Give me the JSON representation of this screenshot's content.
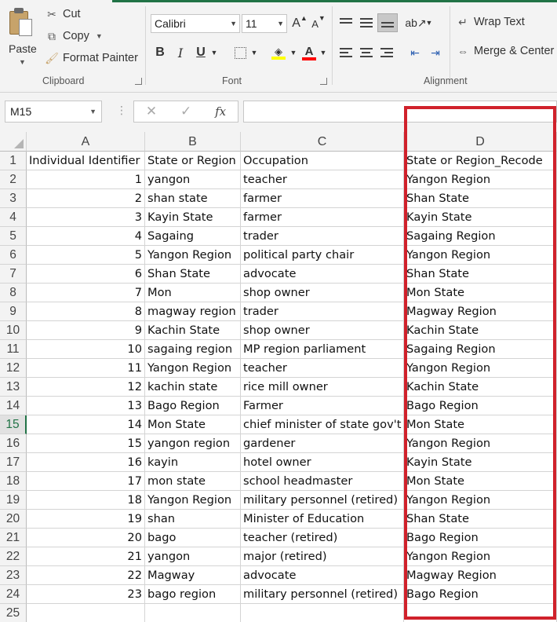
{
  "ribbon": {
    "clipboard": {
      "group_label": "Clipboard",
      "paste": "Paste",
      "cut": "Cut",
      "copy": "Copy",
      "format_painter": "Format Painter"
    },
    "font": {
      "group_label": "Font",
      "font_name": "Calibri",
      "font_size": "11",
      "bold": "B",
      "italic": "I",
      "underline": "U",
      "grow": "A",
      "shrink": "A",
      "font_color_letter": "A",
      "fill_color": "#ffff00",
      "font_color": "#ff0000"
    },
    "alignment": {
      "group_label": "Alignment",
      "wrap_text": "Wrap Text",
      "merge_center": "Merge & Center"
    }
  },
  "formula_bar": {
    "name_box": "M15",
    "cancel": "✕",
    "enter": "✓",
    "fx": "fx",
    "formula": ""
  },
  "sheet": {
    "columns": [
      "A",
      "B",
      "C",
      "D"
    ],
    "active_row": "15",
    "row_numbers": [
      "1",
      "2",
      "3",
      "4",
      "5",
      "6",
      "7",
      "8",
      "9",
      "10",
      "11",
      "12",
      "13",
      "14",
      "15",
      "16",
      "17",
      "18",
      "19",
      "20",
      "21",
      "22",
      "23",
      "24",
      "25"
    ],
    "header": [
      "Individual Identifier",
      "State or Region",
      "Occupation",
      "State or Region_Recode"
    ],
    "rows": [
      [
        "1",
        "yangon",
        "teacher",
        "Yangon Region"
      ],
      [
        "2",
        "shan state",
        "farmer",
        "Shan State"
      ],
      [
        "3",
        "Kayin State",
        "farmer",
        "Kayin State"
      ],
      [
        "4",
        "Sagaing",
        "trader",
        "Sagaing Region"
      ],
      [
        "5",
        "Yangon Region",
        "political party chair",
        "Yangon Region"
      ],
      [
        "6",
        "Shan State",
        "advocate",
        "Shan State"
      ],
      [
        "7",
        "Mon",
        "shop owner",
        "Mon State"
      ],
      [
        "8",
        "magway region",
        "trader",
        "Magway Region"
      ],
      [
        "9",
        "Kachin State",
        "shop owner",
        "Kachin State"
      ],
      [
        "10",
        "sagaing region",
        "MP region parliament",
        "Sagaing Region"
      ],
      [
        "11",
        "Yangon Region",
        "teacher",
        "Yangon Region"
      ],
      [
        "12",
        "kachin state",
        "rice mill owner",
        "Kachin State"
      ],
      [
        "13",
        "Bago Region",
        "Farmer",
        "Bago Region"
      ],
      [
        "14",
        "Mon State",
        "chief minister of state gov't",
        "Mon State"
      ],
      [
        "15",
        "yangon region",
        "gardener",
        "Yangon Region"
      ],
      [
        "16",
        "kayin",
        "hotel owner",
        "Kayin State"
      ],
      [
        "17",
        "mon state",
        "school headmaster",
        "Mon State"
      ],
      [
        "18",
        "Yangon Region",
        "military personnel (retired)",
        "Yangon Region"
      ],
      [
        "19",
        "shan",
        "Minister of Education",
        "Shan State"
      ],
      [
        "20",
        "bago",
        "teacher (retired)",
        "Bago Region"
      ],
      [
        "21",
        "yangon",
        "major (retired)",
        "Yangon Region"
      ],
      [
        "22",
        "Magway",
        "advocate",
        "Magway Region"
      ],
      [
        "23",
        "bago region",
        "military personnel (retired)",
        "Bago Region"
      ]
    ]
  },
  "annotation": {
    "color": "#d0212b"
  }
}
